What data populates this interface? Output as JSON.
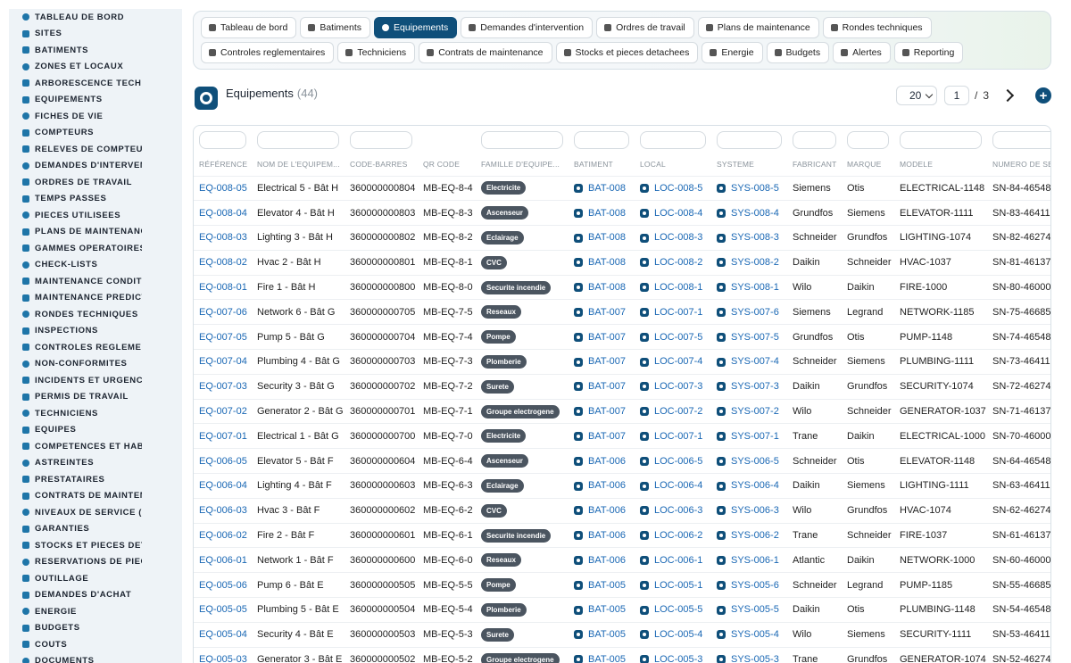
{
  "sidebar": {
    "items": [
      {
        "label": "TABLEAU DE BORD",
        "icon": "dashboard-icon"
      },
      {
        "label": "SITES",
        "icon": "location-pin-icon"
      },
      {
        "label": "BATIMENTS",
        "icon": "building-icon"
      },
      {
        "label": "ZONES ET LOCAUX",
        "icon": "grid-icon"
      },
      {
        "label": "ARBORESCENCE TECHNI",
        "icon": "tree-icon"
      },
      {
        "label": "EQUIPEMENTS",
        "icon": "gears-icon"
      },
      {
        "label": "FICHES DE VIE",
        "icon": "history-icon"
      },
      {
        "label": "COMPTEURS",
        "icon": "gauge-icon"
      },
      {
        "label": "RELEVES DE COMPTEURS",
        "icon": "clipboard-icon"
      },
      {
        "label": "DEMANDES D'INTERVENT",
        "icon": "question-icon"
      },
      {
        "label": "ORDRES DE TRAVAIL",
        "icon": "clipboard-list-icon"
      },
      {
        "label": "TEMPS PASSES",
        "icon": "clock-icon"
      },
      {
        "label": "PIECES UTILISEES",
        "icon": "puzzle-icon"
      },
      {
        "label": "PLANS DE MAINTENANCE",
        "icon": "calendar-icon"
      },
      {
        "label": "GAMMES OPERATOIRES",
        "icon": "list-icon"
      },
      {
        "label": "CHECK-LISTS",
        "icon": "checklist-icon"
      },
      {
        "label": "MAINTENANCE CONDITIO",
        "icon": "thermometer-icon"
      },
      {
        "label": "MAINTENANCE PREDICTI",
        "icon": "chart-line-icon"
      },
      {
        "label": "RONDES TECHNIQUES",
        "icon": "route-icon"
      },
      {
        "label": "INSPECTIONS",
        "icon": "search-icon"
      },
      {
        "label": "CONTROLES REGLEMENT",
        "icon": "shield-check-icon"
      },
      {
        "label": "NON-CONFORMITES",
        "icon": "warning-circle-icon"
      },
      {
        "label": "INCIDENTS ET URGENCES",
        "icon": "alert-triangle-icon"
      },
      {
        "label": "PERMIS DE TRAVAIL",
        "icon": "document-icon"
      },
      {
        "label": "TECHNICIENS",
        "icon": "user-hardhat-icon"
      },
      {
        "label": "EQUIPES",
        "icon": "users-icon"
      },
      {
        "label": "COMPETENCES ET HABIL",
        "icon": "certificate-icon"
      },
      {
        "label": "ASTREINTES",
        "icon": "phone-icon"
      },
      {
        "label": "PRESTATAIRES",
        "icon": "handshake-icon"
      },
      {
        "label": "CONTRATS DE MAINTENA",
        "icon": "contract-icon"
      },
      {
        "label": "NIVEAUX DE SERVICE (SL",
        "icon": "speedometer-icon"
      },
      {
        "label": "GARANTIES",
        "icon": "shield-icon"
      },
      {
        "label": "STOCKS ET PIECES DETA",
        "icon": "boxes-icon"
      },
      {
        "label": "RESERVATIONS DE PIECE",
        "icon": "bookmark-icon"
      },
      {
        "label": "OUTILLAGE",
        "icon": "tools-icon"
      },
      {
        "label": "DEMANDES D'ACHAT",
        "icon": "cart-icon"
      },
      {
        "label": "ENERGIE",
        "icon": "bolt-icon"
      },
      {
        "label": "BUDGETS",
        "icon": "money-icon"
      },
      {
        "label": "COUTS",
        "icon": "coins-icon"
      },
      {
        "label": "DOCUMENTS",
        "icon": "folder-icon"
      }
    ]
  },
  "topnav": {
    "row1": [
      {
        "label": "Tableau de bord",
        "icon": "dashboard-icon",
        "active": false
      },
      {
        "label": "Batiments",
        "icon": "building-icon",
        "active": false
      },
      {
        "label": "Equipements",
        "icon": "gears-icon",
        "active": true
      },
      {
        "label": "Demandes d'intervention",
        "icon": "question-icon",
        "active": false
      },
      {
        "label": "Ordres de travail",
        "icon": "clipboard-icon",
        "active": false
      },
      {
        "label": "Plans de maintenance",
        "icon": "calendar-icon",
        "active": false
      },
      {
        "label": "Rondes techniques",
        "icon": "route-icon",
        "active": false
      }
    ],
    "row2": [
      {
        "label": "Controles reglementaires",
        "icon": "shield-check-icon",
        "active": false
      },
      {
        "label": "Techniciens",
        "icon": "user-hardhat-icon",
        "active": false
      },
      {
        "label": "Contrats de maintenance",
        "icon": "contract-icon",
        "active": false
      },
      {
        "label": "Stocks et pieces detachees",
        "icon": "boxes-icon",
        "active": false
      },
      {
        "label": "Energie",
        "icon": "bolt-icon",
        "active": false
      },
      {
        "label": "Budgets",
        "icon": "money-icon",
        "active": false
      },
      {
        "label": "Alertes",
        "icon": "bell-icon",
        "active": false
      },
      {
        "label": "Reporting",
        "icon": "pie-chart-icon",
        "active": false
      }
    ]
  },
  "page": {
    "title": "Equipements",
    "count": "(44)",
    "page_size": "20",
    "current_page": "1",
    "separator": "/",
    "total_pages": "3",
    "add_label": "+"
  },
  "table": {
    "columns": [
      "RÉFÉRENCE",
      "NOM DE L'EQUIPEM...",
      "CODE-BARRES",
      "QR CODE",
      "FAMILLE D'EQUIPE...",
      "BATIMENT",
      "LOCAL",
      "SYSTEME",
      "FABRICANT",
      "MARQUE",
      "MODELE",
      "NUMERO DE SE"
    ],
    "rows": [
      [
        "EQ-008-05",
        "Electrical 5 - Bât H",
        "360000000804",
        "MB-EQ-8-4",
        "Electricite",
        "BAT-008",
        "LOC-008-5",
        "SYS-008-5",
        "Siemens",
        "Otis",
        "ELECTRICAL-1148",
        "SN-84-46548"
      ],
      [
        "EQ-008-04",
        "Elevator 4 - Bât H",
        "360000000803",
        "MB-EQ-8-3",
        "Ascenseur",
        "BAT-008",
        "LOC-008-4",
        "SYS-008-4",
        "Grundfos",
        "Siemens",
        "ELEVATOR-1111",
        "SN-83-46411"
      ],
      [
        "EQ-008-03",
        "Lighting 3 - Bât H",
        "360000000802",
        "MB-EQ-8-2",
        "Eclairage",
        "BAT-008",
        "LOC-008-3",
        "SYS-008-3",
        "Schneider",
        "Grundfos",
        "LIGHTING-1074",
        "SN-82-46274"
      ],
      [
        "EQ-008-02",
        "Hvac 2 - Bât H",
        "360000000801",
        "MB-EQ-8-1",
        "CVC",
        "BAT-008",
        "LOC-008-2",
        "SYS-008-2",
        "Daikin",
        "Schneider",
        "HVAC-1037",
        "SN-81-46137"
      ],
      [
        "EQ-008-01",
        "Fire 1 - Bât H",
        "360000000800",
        "MB-EQ-8-0",
        "Securite incendie",
        "BAT-008",
        "LOC-008-1",
        "SYS-008-1",
        "Wilo",
        "Daikin",
        "FIRE-1000",
        "SN-80-46000"
      ],
      [
        "EQ-007-06",
        "Network 6 - Bât G",
        "360000000705",
        "MB-EQ-7-5",
        "Reseaux",
        "BAT-007",
        "LOC-007-1",
        "SYS-007-6",
        "Siemens",
        "Legrand",
        "NETWORK-1185",
        "SN-75-46685"
      ],
      [
        "EQ-007-05",
        "Pump 5 - Bât G",
        "360000000704",
        "MB-EQ-7-4",
        "Pompe",
        "BAT-007",
        "LOC-007-5",
        "SYS-007-5",
        "Grundfos",
        "Otis",
        "PUMP-1148",
        "SN-74-46548"
      ],
      [
        "EQ-007-04",
        "Plumbing 4 - Bât G",
        "360000000703",
        "MB-EQ-7-3",
        "Plomberie",
        "BAT-007",
        "LOC-007-4",
        "SYS-007-4",
        "Schneider",
        "Siemens",
        "PLUMBING-1111",
        "SN-73-46411"
      ],
      [
        "EQ-007-03",
        "Security 3 - Bât G",
        "360000000702",
        "MB-EQ-7-2",
        "Surete",
        "BAT-007",
        "LOC-007-3",
        "SYS-007-3",
        "Daikin",
        "Grundfos",
        "SECURITY-1074",
        "SN-72-46274"
      ],
      [
        "EQ-007-02",
        "Generator 2 - Bât G",
        "360000000701",
        "MB-EQ-7-1",
        "Groupe electrogene",
        "BAT-007",
        "LOC-007-2",
        "SYS-007-2",
        "Wilo",
        "Schneider",
        "GENERATOR-1037",
        "SN-71-46137"
      ],
      [
        "EQ-007-01",
        "Electrical 1 - Bât G",
        "360000000700",
        "MB-EQ-7-0",
        "Electricite",
        "BAT-007",
        "LOC-007-1",
        "SYS-007-1",
        "Trane",
        "Daikin",
        "ELECTRICAL-1000",
        "SN-70-46000"
      ],
      [
        "EQ-006-05",
        "Elevator 5 - Bât F",
        "360000000604",
        "MB-EQ-6-4",
        "Ascenseur",
        "BAT-006",
        "LOC-006-5",
        "SYS-006-5",
        "Schneider",
        "Otis",
        "ELEVATOR-1148",
        "SN-64-46548"
      ],
      [
        "EQ-006-04",
        "Lighting 4 - Bât F",
        "360000000603",
        "MB-EQ-6-3",
        "Eclairage",
        "BAT-006",
        "LOC-006-4",
        "SYS-006-4",
        "Daikin",
        "Siemens",
        "LIGHTING-1111",
        "SN-63-46411"
      ],
      [
        "EQ-006-03",
        "Hvac 3 - Bât F",
        "360000000602",
        "MB-EQ-6-2",
        "CVC",
        "BAT-006",
        "LOC-006-3",
        "SYS-006-3",
        "Wilo",
        "Grundfos",
        "HVAC-1074",
        "SN-62-46274"
      ],
      [
        "EQ-006-02",
        "Fire 2 - Bât F",
        "360000000601",
        "MB-EQ-6-1",
        "Securite incendie",
        "BAT-006",
        "LOC-006-2",
        "SYS-006-2",
        "Trane",
        "Schneider",
        "FIRE-1037",
        "SN-61-46137"
      ],
      [
        "EQ-006-01",
        "Network 1 - Bât F",
        "360000000600",
        "MB-EQ-6-0",
        "Reseaux",
        "BAT-006",
        "LOC-006-1",
        "SYS-006-1",
        "Atlantic",
        "Daikin",
        "NETWORK-1000",
        "SN-60-46000"
      ],
      [
        "EQ-005-06",
        "Pump 6 - Bât E",
        "360000000505",
        "MB-EQ-5-5",
        "Pompe",
        "BAT-005",
        "LOC-005-1",
        "SYS-005-6",
        "Schneider",
        "Legrand",
        "PUMP-1185",
        "SN-55-46685"
      ],
      [
        "EQ-005-05",
        "Plumbing 5 - Bât E",
        "360000000504",
        "MB-EQ-5-4",
        "Plomberie",
        "BAT-005",
        "LOC-005-5",
        "SYS-005-5",
        "Daikin",
        "Otis",
        "PLUMBING-1148",
        "SN-54-46548"
      ],
      [
        "EQ-005-04",
        "Security 4 - Bât E",
        "360000000503",
        "MB-EQ-5-3",
        "Surete",
        "BAT-005",
        "LOC-005-4",
        "SYS-005-4",
        "Wilo",
        "Siemens",
        "SECURITY-1111",
        "SN-53-46411"
      ],
      [
        "EQ-005-03",
        "Generator 3 - Bât E",
        "360000000502",
        "MB-EQ-5-2",
        "Groupe electrogene",
        "BAT-005",
        "LOC-005-3",
        "SYS-005-3",
        "Trane",
        "Grundfos",
        "GENERATOR-1074",
        "SN-52-46274"
      ]
    ]
  }
}
